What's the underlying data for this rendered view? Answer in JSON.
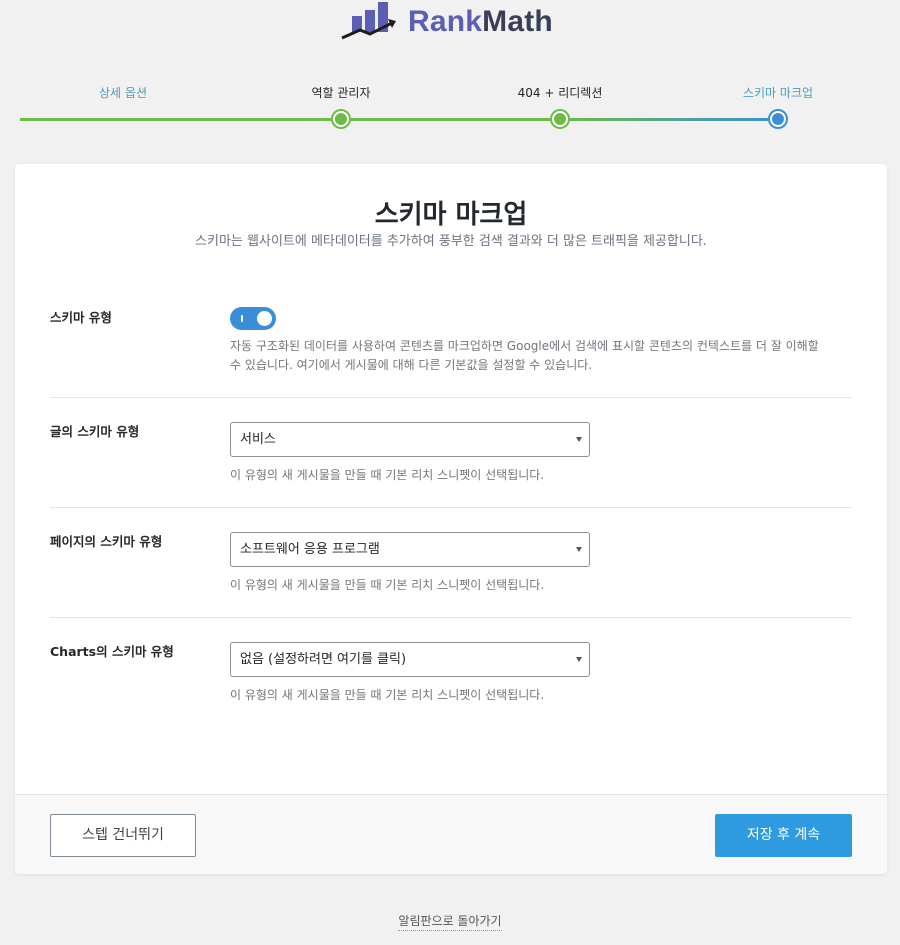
{
  "logo": {
    "rank": "Rank",
    "math": "Math"
  },
  "steps": [
    {
      "label": "상세 옵션",
      "state": "done"
    },
    {
      "label": "역할 관리자",
      "state": "done"
    },
    {
      "label": "404 + 리디렉션",
      "state": "done"
    },
    {
      "label": "스키마 마크업",
      "state": "active"
    }
  ],
  "colors": {
    "green": "#6cbb46",
    "blue": "#3a8ed8",
    "button": "#2e9be0"
  },
  "main": {
    "title": "스키마 마크업",
    "description": "스키마는 웹사이트에 메타데이터를 추가하여 풍부한 검색 결과와 더 많은 트래픽을 제공합니다."
  },
  "schema_type": {
    "label": "스키마 유형",
    "toggle_on": true,
    "help": "자동 구조화된 데이터를 사용하여 콘텐츠를 마크업하면 Google에서 검색에 표시할 콘텐츠의 컨텍스트를 더 잘 이해할 수 있습니다. 여기에서 게시물에 대해 다른 기본값을 설정할 수 있습니다."
  },
  "post_schema": {
    "label": "글의 스키마 유형",
    "value": "서비스",
    "help": "이 유형의 새 게시물을 만들 때 기본 리치 스니펫이 선택됩니다."
  },
  "page_schema": {
    "label": "페이지의 스키마 유형",
    "value": "소프트웨어 응용 프로그램",
    "help": "이 유형의 새 게시물을 만들 때 기본 리치 스니펫이 선택됩니다."
  },
  "charts_schema": {
    "label": "Charts의 스키마 유형",
    "value": "없음 (설정하려면 여기를 클릭)",
    "help": "이 유형의 새 게시물을 만들 때 기본 리치 스니펫이 선택됩니다."
  },
  "footer": {
    "skip_label": "스텝 건너뛰기",
    "save_label": "저장 후 계속"
  },
  "back_link": "알림판으로 돌아가기"
}
